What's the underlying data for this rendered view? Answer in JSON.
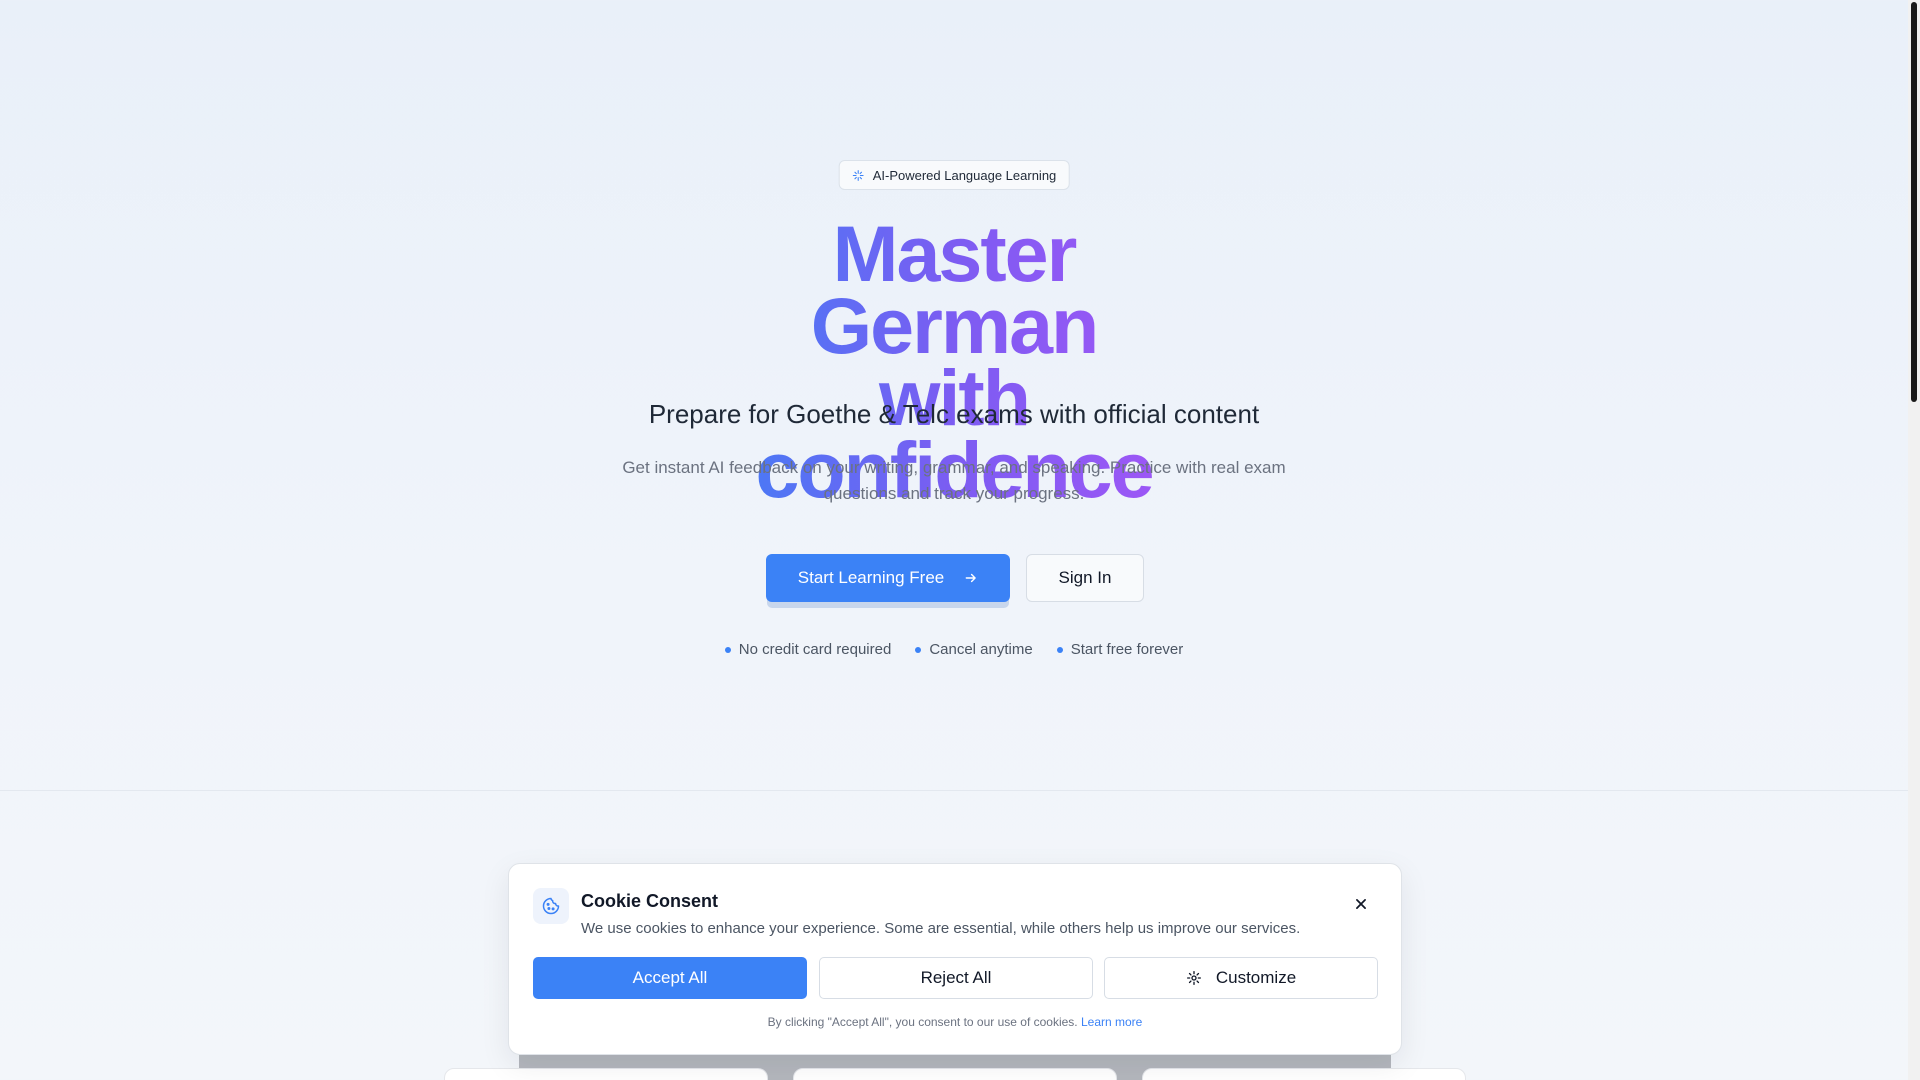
{
  "hero": {
    "badge": "AI-Powered Language Learning",
    "headline_line1": "Master German",
    "headline_line2": "with confidence",
    "subtitle": "Prepare for Goethe & Telc exams with official content",
    "description": "Get instant AI feedback on your writing, grammar, and speaking. Practice with real exam questions and track your progress.",
    "primary_cta": "Start Learning Free",
    "secondary_cta": "Sign In",
    "perks": [
      "No credit card required",
      "Cancel anytime",
      "Start free forever"
    ]
  },
  "cookie": {
    "title": "Cookie Consent",
    "text": "We use cookies to enhance your experience. Some are essential, while others help us improve our services.",
    "accept": "Accept All",
    "reject": "Reject All",
    "customize": "Customize",
    "footer_text": "By clicking \"Accept All\", you consent to our use of cookies.",
    "learn_more": "Learn more"
  },
  "icons": {
    "badge": "sparkles-icon",
    "cta": "arrow-right-icon",
    "cookie": "cookie-icon",
    "close": "close-icon",
    "customize": "gear-icon"
  },
  "colors": {
    "accent": "#3b82f6",
    "gradient_start": "#3b82f6",
    "gradient_end": "#a855f7"
  }
}
